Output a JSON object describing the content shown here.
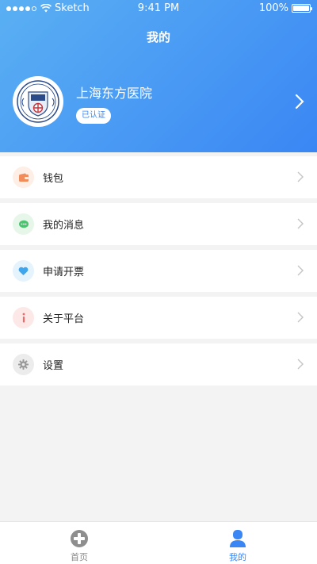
{
  "status_bar": {
    "carrier": "Sketch",
    "time": "9:41 PM",
    "battery": "100%"
  },
  "header": {
    "title": "我的"
  },
  "profile": {
    "name": "上海东方医院",
    "badge": "已认证"
  },
  "menu": [
    {
      "label": "钱包",
      "icon": "wallet-icon",
      "color": "#f18d5a",
      "bg": "#fdeee6"
    },
    {
      "label": "我的消息",
      "icon": "message-icon",
      "color": "#4cc36f",
      "bg": "#e6f7ea"
    },
    {
      "label": "申请开票",
      "icon": "heart-icon",
      "color": "#3fa6ee",
      "bg": "#e5f3fd"
    },
    {
      "label": "关于平台",
      "icon": "info-icon",
      "color": "#ee6a6a",
      "bg": "#fde8e8"
    },
    {
      "label": "设置",
      "icon": "gear-icon",
      "color": "#9a9a9a",
      "bg": "#ececec"
    }
  ],
  "tabbar": {
    "home_label": "首页",
    "mine_label": "我的"
  },
  "colors": {
    "primary": "#3a86f4",
    "header_gradient_start": "#5ab0f3"
  }
}
